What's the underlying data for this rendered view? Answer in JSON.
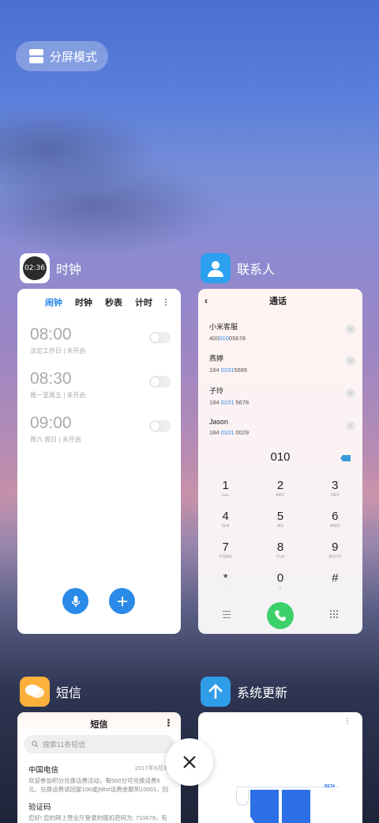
{
  "split_mode": {
    "label": "分屏模式"
  },
  "apps": {
    "clock": {
      "name": "时钟",
      "icon_time": "02:36",
      "tabs": [
        "闹钟",
        "时钟",
        "秒表",
        "计时"
      ],
      "alarms": [
        {
          "time": "08:00",
          "desc": "法定工作日 | 未开启"
        },
        {
          "time": "08:30",
          "desc": "周一至周五 | 未开启"
        },
        {
          "time": "09:00",
          "desc": "周六 周日 | 未开启"
        }
      ]
    },
    "contacts": {
      "name": "联系人",
      "screen_title": "通话",
      "contacts": [
        {
          "name": "小米客服",
          "num_pre": "400",
          "num_hi": "010",
          "num_post": "05678"
        },
        {
          "name": "燕婷",
          "num_pre": "184 ",
          "num_hi": "0101",
          "num_post": "5689"
        },
        {
          "name": "子玲",
          "num_pre": "184 ",
          "num_hi": "0101",
          "num_post": " 5678"
        },
        {
          "name": "Jason",
          "num_pre": "184 ",
          "num_hi": "0101",
          "num_post": " 0029"
        }
      ],
      "typed": "010",
      "keys": [
        {
          "d": "1",
          "l": "ωω"
        },
        {
          "d": "2",
          "l": "ABC"
        },
        {
          "d": "3",
          "l": "DEF"
        },
        {
          "d": "4",
          "l": "GHI"
        },
        {
          "d": "5",
          "l": "JKL"
        },
        {
          "d": "6",
          "l": "MNO"
        },
        {
          "d": "7",
          "l": "PQRS"
        },
        {
          "d": "8",
          "l": "TUV"
        },
        {
          "d": "9",
          "l": "WXYZ"
        },
        {
          "d": "*",
          "l": ","
        },
        {
          "d": "0",
          "l": "+"
        },
        {
          "d": "#",
          "l": ""
        }
      ]
    },
    "sms": {
      "name": "短信",
      "screen_title": "短信",
      "search_placeholder": "搜索11条短信",
      "messages": [
        {
          "sender": "中国电信",
          "date": "2017年6月30",
          "text": "欢迎参加积分兑换话费活动，每500分可兑换话费5元。兑换话费请回复106或jfdh#话费金额到10001，回复..."
        },
        {
          "sender": "验证码",
          "date": "",
          "text": "您好! 您的网上营业厅登录的随机密码为: 710679，有"
        }
      ]
    },
    "update": {
      "name": "系统更新",
      "badge": "BETA"
    }
  },
  "colors": {
    "accent": "#2a8ae8",
    "call_green": "#3cd06a"
  }
}
